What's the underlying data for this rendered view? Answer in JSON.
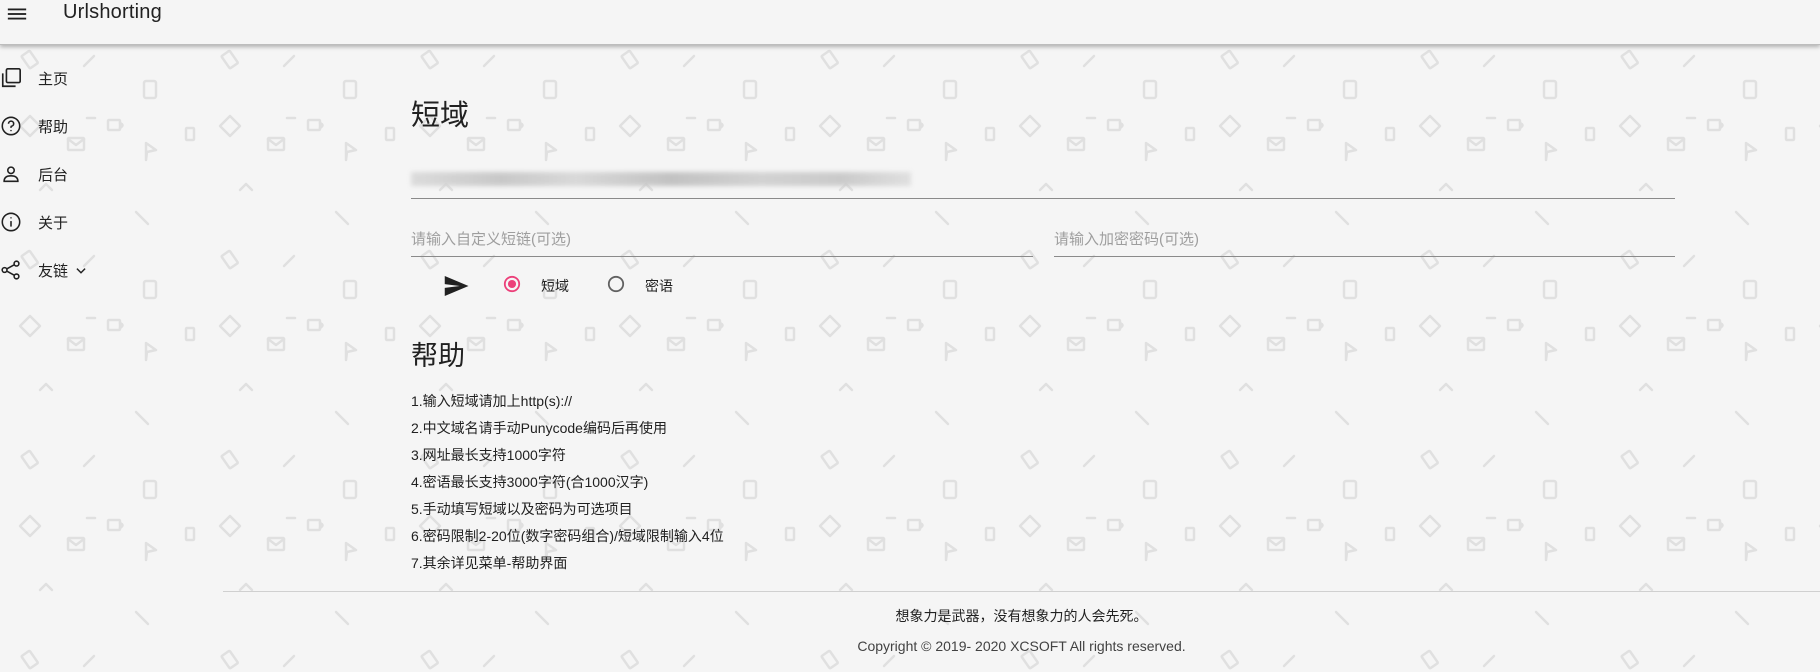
{
  "app": {
    "title": "Urlshorting"
  },
  "sidebar": {
    "items": [
      {
        "label": "主页",
        "icon": "library-icon"
      },
      {
        "label": "帮助",
        "icon": "help-circle-icon"
      },
      {
        "label": "后台",
        "icon": "person-icon"
      },
      {
        "label": "关于",
        "icon": "info-icon"
      },
      {
        "label": "友链",
        "icon": "share-icon",
        "expandable": true
      }
    ]
  },
  "main": {
    "title": "短域",
    "custom_short_placeholder": "请输入自定义短链(可选)",
    "password_placeholder": "请输入加密密码(可选)",
    "radios": [
      {
        "label": "短域",
        "selected": true
      },
      {
        "label": "密语",
        "selected": false
      }
    ]
  },
  "help": {
    "title": "帮助",
    "items": [
      "1.输入短域请加上http(s)://",
      "2.中文域名请手动Punycode编码后再使用",
      "3.网址最长支持1000字符",
      "4.密语最长支持3000字符(合1000汉字)",
      "5.手动填写短域以及密码为可选项目",
      "6.密码限制2-20位(数字密码组合)/短域限制输入4位",
      "7.其余详见菜单-帮助界面"
    ]
  },
  "footer": {
    "motto": "想象力是武器，没有想象力的人会先死。",
    "copyright": "Copyright © 2019- 2020 XCSOFT All rights reserved."
  },
  "colors": {
    "accent": "#ec407a",
    "background": "#f5f5f5",
    "text": "#212121",
    "pattern": "#e0e0e0"
  }
}
